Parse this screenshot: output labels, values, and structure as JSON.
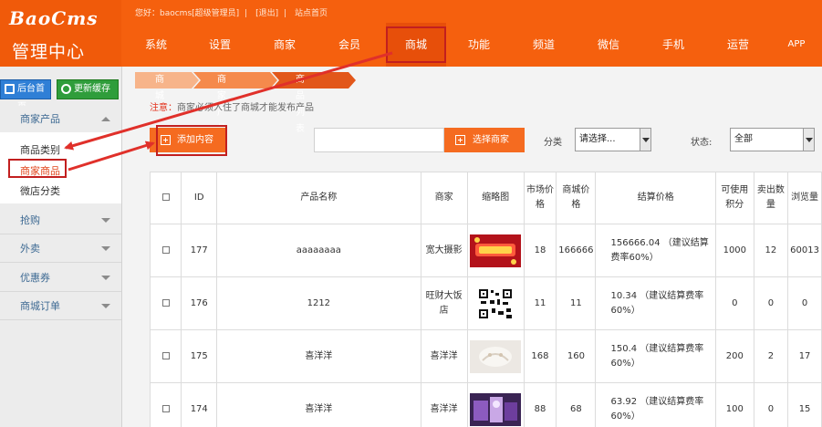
{
  "logo": {
    "brand": "BaoCms",
    "subtitle": "管理中心"
  },
  "topbar": {
    "greeting": "您好：baocms[超级管理员]",
    "logout": "[退出]",
    "site_home": "站点首页"
  },
  "nav": [
    {
      "label": "系统",
      "active": false
    },
    {
      "label": "设置",
      "active": false
    },
    {
      "label": "商家",
      "active": false
    },
    {
      "label": "会员",
      "active": false
    },
    {
      "label": "商城",
      "active": true
    },
    {
      "label": "功能",
      "active": false
    },
    {
      "label": "频道",
      "active": false
    },
    {
      "label": "微信",
      "active": false
    },
    {
      "label": "手机",
      "active": false
    },
    {
      "label": "运营",
      "active": false
    },
    {
      "label": "APP",
      "active": false
    }
  ],
  "sidebar": {
    "home_button": "后台首页",
    "cache_button": "更新缓存",
    "groups": [
      {
        "label": "商家产品",
        "expanded": true
      },
      {
        "label": "抢购",
        "expanded": false
      },
      {
        "label": "外卖",
        "expanded": false
      },
      {
        "label": "优惠券",
        "expanded": false
      },
      {
        "label": "商城订单",
        "expanded": false
      }
    ],
    "sub_items": [
      {
        "label": "商品类别"
      },
      {
        "label": "商家商品",
        "selected": true
      },
      {
        "label": "微店分类"
      }
    ]
  },
  "breadcrumb": [
    "商城",
    "商家产品",
    "商品列表"
  ],
  "notice": {
    "prefix": "注意：",
    "text": "商家必须入住了商城才能发布产品"
  },
  "toolbar": {
    "add_button": "添加内容",
    "search_value": "",
    "select_merchant_button": "选择商家",
    "category_label": "分类",
    "category_value": "请选择...",
    "status_label": "状态:",
    "status_value": "全部"
  },
  "table": {
    "headers": [
      "",
      "ID",
      "产品名称",
      "商家",
      "缩略图",
      "市场价格",
      "商城价格",
      "结算价格",
      "可使用积分",
      "卖出数量",
      "浏览量"
    ],
    "rows": [
      {
        "id": "177",
        "name": "aaaaaaaa",
        "merchant": "宽大摄影",
        "thumb": "red-banner",
        "market": "18",
        "mall": "166666",
        "settle": "156666.04 （建议结算费率60%）",
        "points": "1000",
        "sold": "12",
        "views": "60013"
      },
      {
        "id": "176",
        "name": "1212",
        "merchant": "旺财大饭店",
        "thumb": "qr-code",
        "market": "11",
        "mall": "11",
        "settle": "10.34 （建议结算费率60%）",
        "points": "0",
        "sold": "0",
        "views": "0"
      },
      {
        "id": "175",
        "name": "喜洋洋",
        "merchant": "喜洋洋",
        "thumb": "light-photo",
        "market": "168",
        "mall": "160",
        "settle": "150.4 （建议结算费率60%）",
        "points": "200",
        "sold": "2",
        "views": "17"
      },
      {
        "id": "174",
        "name": "喜洋洋",
        "merchant": "喜洋洋",
        "thumb": "purple-photo",
        "market": "88",
        "mall": "68",
        "settle": "63.92 （建议结算费率60%）",
        "points": "100",
        "sold": "0",
        "views": "15"
      }
    ]
  },
  "colors": {
    "header": "#f5600e",
    "accent": "#f56b20",
    "annotation": "#c21f1f",
    "link": "#3e6a93"
  }
}
